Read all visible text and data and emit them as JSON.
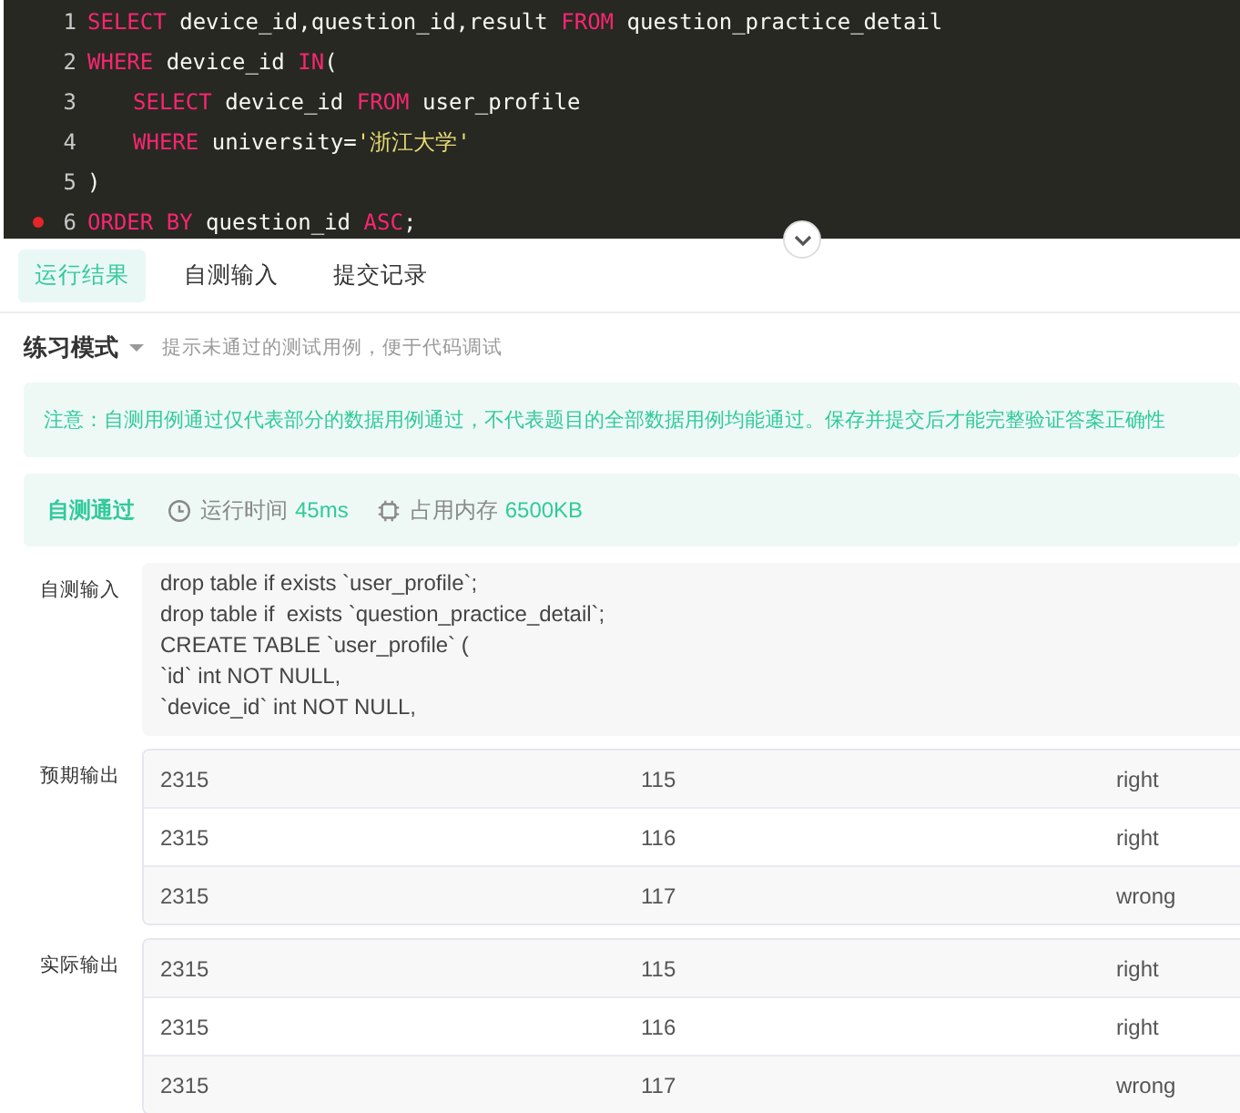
{
  "editor": {
    "lines": [
      {
        "number": "1",
        "breakpoint": false,
        "indent": false,
        "tokens": [
          {
            "kind": "keyword",
            "text": "SELECT"
          },
          {
            "kind": "plain",
            "text": "device_id,question_id,result"
          },
          {
            "kind": "keyword",
            "text": "FROM"
          },
          {
            "kind": "plain",
            "text": "question_practice_detail"
          }
        ]
      },
      {
        "number": "2",
        "breakpoint": false,
        "indent": false,
        "tokens": [
          {
            "kind": "keyword",
            "text": "WHERE"
          },
          {
            "kind": "plain",
            "text": "device_id"
          },
          {
            "kind": "keyword",
            "text": "IN"
          },
          {
            "kind": "plain",
            "text": "("
          }
        ]
      },
      {
        "number": "3",
        "breakpoint": false,
        "indent": true,
        "tokens": [
          {
            "kind": "keyword",
            "text": "SELECT"
          },
          {
            "kind": "plain",
            "text": "device_id"
          },
          {
            "kind": "keyword",
            "text": "FROM"
          },
          {
            "kind": "plain",
            "text": "user_profile"
          }
        ]
      },
      {
        "number": "4",
        "breakpoint": false,
        "indent": true,
        "tokens": [
          {
            "kind": "keyword",
            "text": "WHERE"
          },
          {
            "kind": "plain",
            "text": "university="
          },
          {
            "kind": "string",
            "text": "'浙江大学'"
          }
        ]
      },
      {
        "number": "5",
        "breakpoint": false,
        "indent": false,
        "tokens": [
          {
            "kind": "plain",
            "text": ")"
          }
        ]
      },
      {
        "number": "6",
        "breakpoint": true,
        "indent": false,
        "tokens": [
          {
            "kind": "keyword",
            "text": "ORDER BY"
          },
          {
            "kind": "plain",
            "text": "question_id"
          },
          {
            "kind": "keyword",
            "text": "ASC"
          },
          {
            "kind": "plain",
            "text": ";"
          }
        ]
      }
    ]
  },
  "tabs": [
    {
      "label": "运行结果",
      "selected": true
    },
    {
      "label": "自测输入",
      "selected": false
    },
    {
      "label": "提交记录",
      "selected": false
    }
  ],
  "mode": {
    "label": "练习模式",
    "hint": "提示未通过的测试用例，便于代码调试"
  },
  "notice": "注意：自测用例通过仅代表部分的数据用例通过，不代表题目的全部数据用例均能通过。保存并提交后才能完整验证答案正确性",
  "result": {
    "status": "自测通过",
    "time_label": "运行时间",
    "time": "45ms",
    "memory_label": "占用内存",
    "memory": "6500KB"
  },
  "self_input": {
    "label": "自测输入",
    "lines": [
      "drop table if exists `user_profile`;",
      "drop table if  exists `question_practice_detail`;",
      "CREATE TABLE `user_profile` (",
      "`id` int NOT NULL,",
      "`device_id` int NOT NULL,"
    ]
  },
  "outputs": [
    {
      "label": "预期输出",
      "rows": [
        [
          "2315",
          "115",
          "right"
        ],
        [
          "2315",
          "116",
          "right"
        ],
        [
          "2315",
          "117",
          "wrong"
        ]
      ]
    },
    {
      "label": "实际输出",
      "rows": [
        [
          "2315",
          "115",
          "right"
        ],
        [
          "2315",
          "116",
          "right"
        ],
        [
          "2315",
          "117",
          "wrong"
        ]
      ]
    }
  ]
}
